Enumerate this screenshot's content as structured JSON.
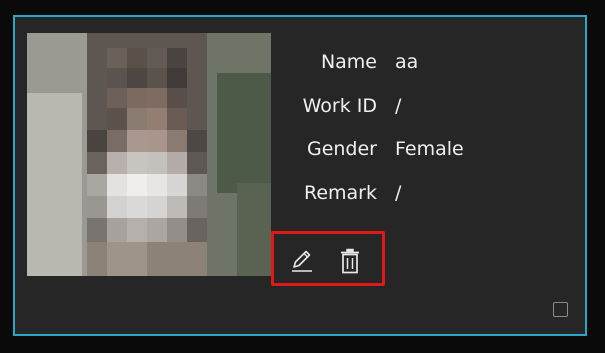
{
  "record": {
    "fields": [
      {
        "label": "Name",
        "value": "aa"
      },
      {
        "label": "Work ID",
        "value": "/"
      },
      {
        "label": "Gender",
        "value": "Female"
      },
      {
        "label": "Remark",
        "value": "/"
      }
    ]
  },
  "actions": {
    "edit_icon": "pencil-icon",
    "delete_icon": "trash-icon",
    "highlight_color": "#e01818"
  },
  "card": {
    "border_color": "#2aa7c8",
    "checkbox_checked": false
  }
}
